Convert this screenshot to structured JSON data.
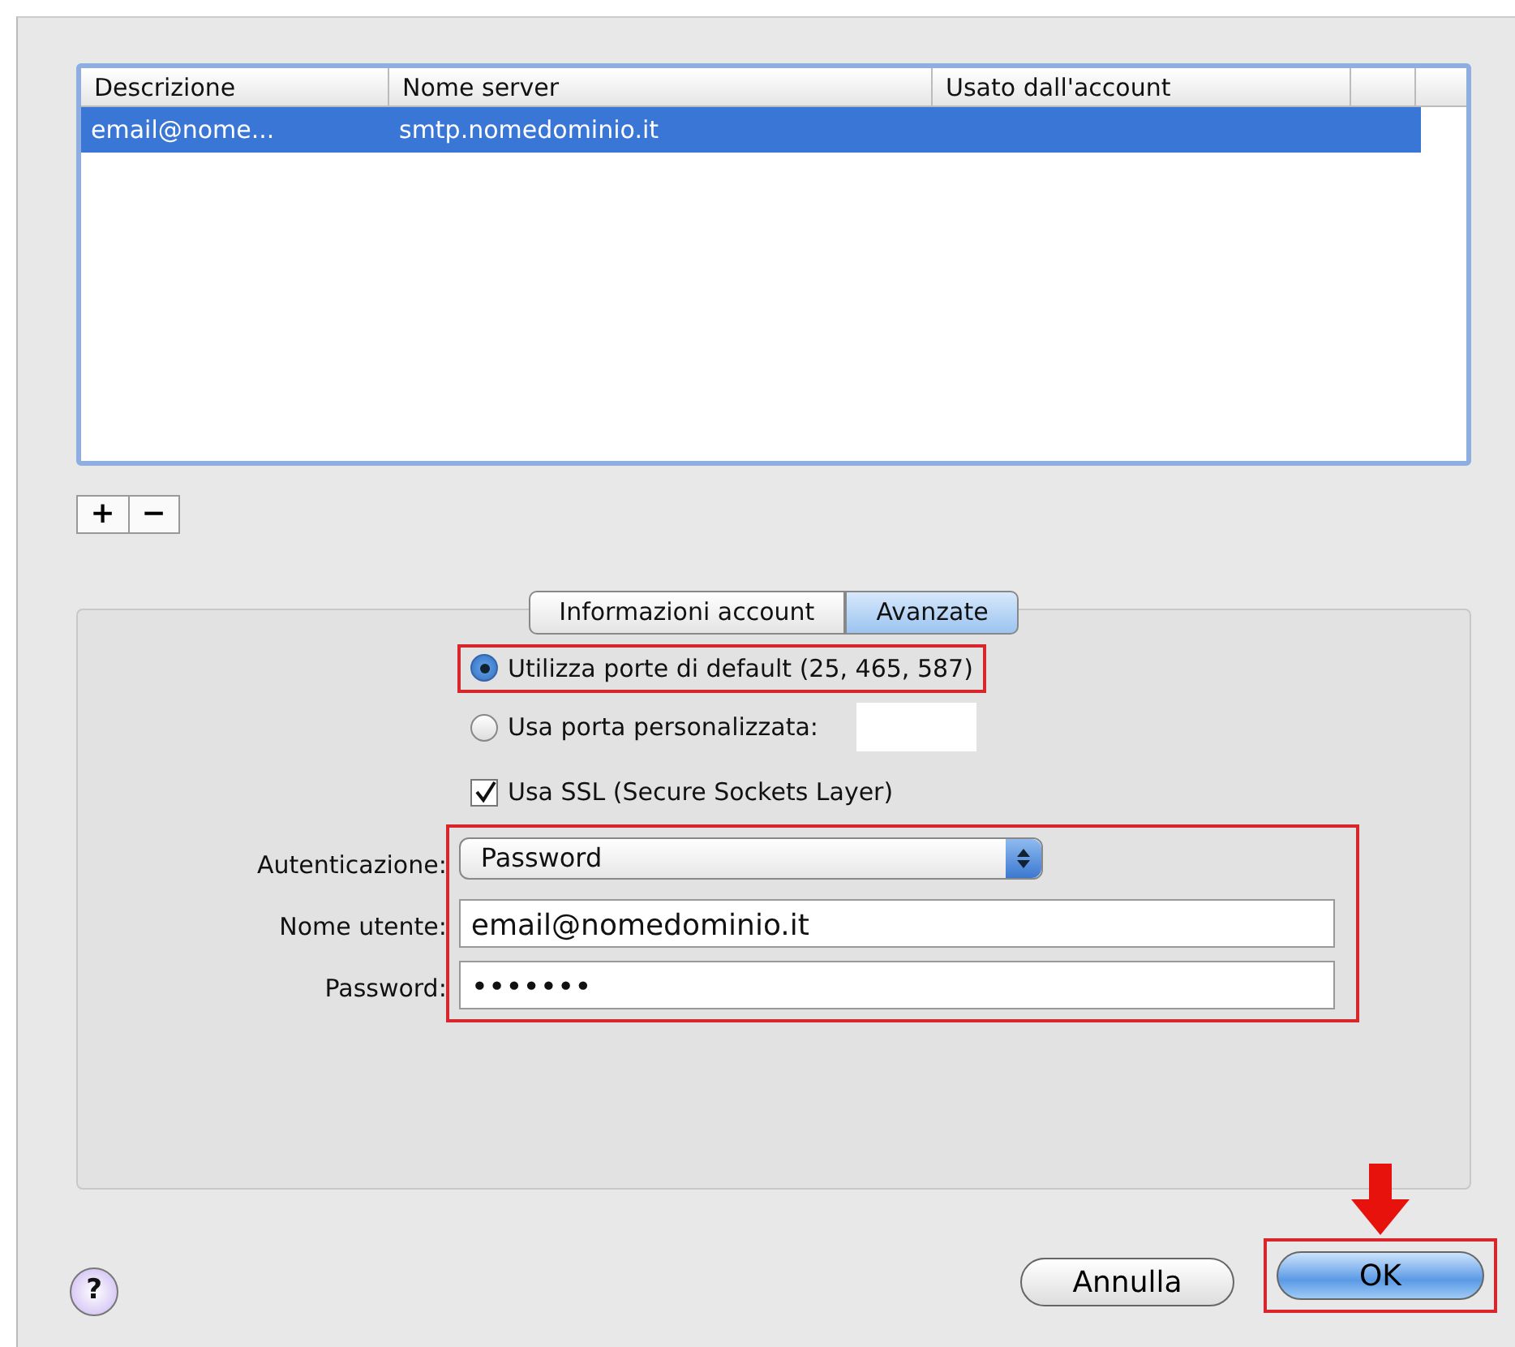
{
  "table": {
    "columns": [
      "Descrizione",
      "Nome server",
      "Usato dall'account"
    ],
    "rows": [
      {
        "cells": [
          "email@nome...",
          "smtp.nomedominio.it",
          ""
        ],
        "selected": true
      }
    ]
  },
  "list_buttons": [
    "+",
    "−"
  ],
  "tabs": [
    {
      "label": "Informazioni account",
      "selected": false
    },
    {
      "label": "Avanzate",
      "selected": true
    }
  ],
  "port_options": [
    {
      "label": "Utilizza porte di default (25, 465, 587)",
      "selected": true,
      "highlighted": true
    },
    {
      "label": "Usa porta personalizzata:",
      "selected": false,
      "highlighted": false
    }
  ],
  "ssl": {
    "label": "Usa SSL (Secure Sockets Layer)",
    "checked": true
  },
  "auth_highlighted": true,
  "auth_fields": [
    {
      "kind": "select",
      "label": "Autenticazione:",
      "value": "Password"
    },
    {
      "kind": "text",
      "label": "Nome utente:",
      "value": "email@nomedominio.it"
    },
    {
      "kind": "text",
      "label": "Password:",
      "value": "•••••••"
    }
  ],
  "help": "?",
  "buttons": [
    {
      "label": "Annulla",
      "default": false,
      "highlighted": false
    },
    {
      "label": "OK",
      "default": true,
      "highlighted": true
    }
  ]
}
